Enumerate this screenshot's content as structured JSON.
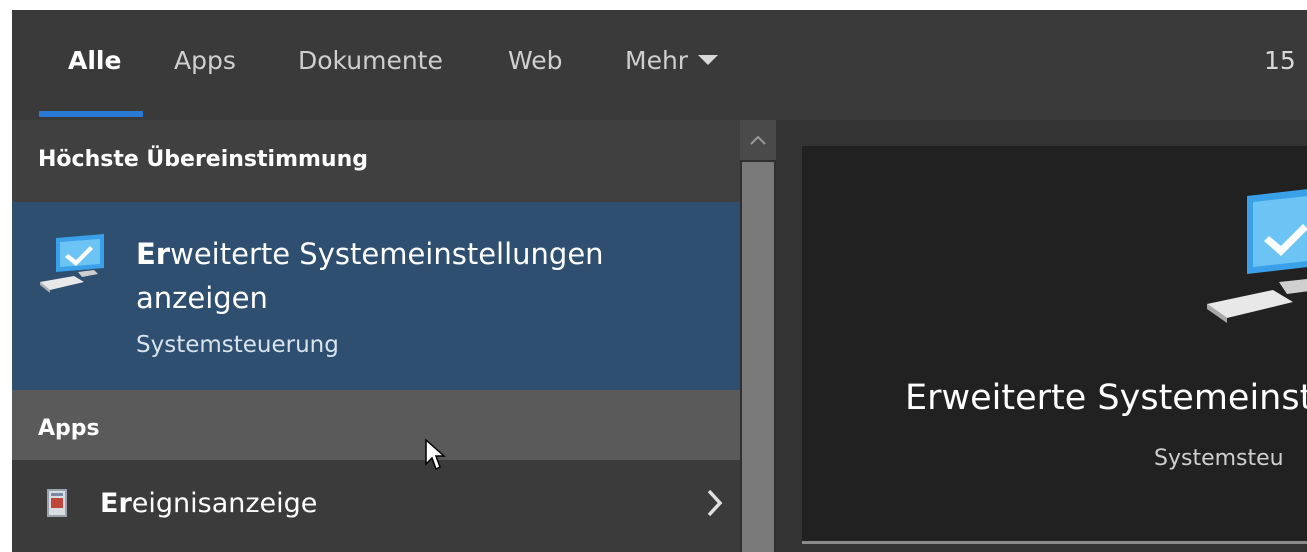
{
  "tabs": [
    {
      "label": "Alle",
      "active": true
    },
    {
      "label": "Apps",
      "active": false
    },
    {
      "label": "Dokumente",
      "active": false
    },
    {
      "label": "Web",
      "active": false
    },
    {
      "label": "Mehr",
      "active": false
    }
  ],
  "tabbar_count": "15",
  "best_match_section": {
    "header": "Höchste Übereinstimmung",
    "item": {
      "title_bold": "Er",
      "title_rest_line1": "weiterte Systemeinstellungen",
      "title_line2": "anzeigen",
      "subtitle": "Systemsteuerung",
      "icon": "computer-settings-icon"
    }
  },
  "apps_section": {
    "header": "Apps",
    "items": [
      {
        "label_bold": "Er",
        "label_rest": "eignisanzeige",
        "icon": "event-viewer-icon",
        "chevron": "chevron-right-icon"
      }
    ]
  },
  "preview": {
    "title": "Erweiterte Systemeinst",
    "subtitle": "Systemsteu",
    "icon": "computer-settings-icon"
  },
  "colors": {
    "accent": "#2a7ad5",
    "selected_bg": "#2e4f70",
    "panel_bg": "#3b3b3b",
    "tabbar_bg": "#3a3a3a",
    "preview_bg": "#212121"
  }
}
